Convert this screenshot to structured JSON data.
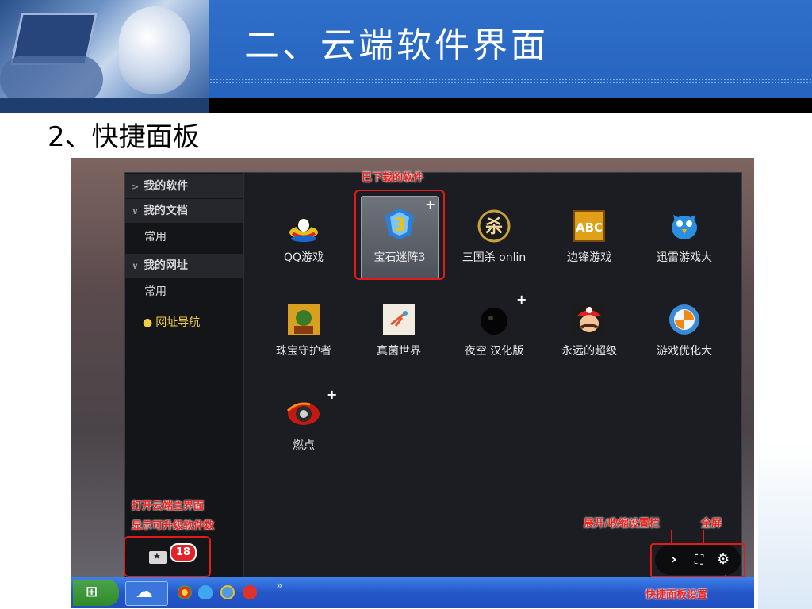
{
  "slide": {
    "title": "二、云端软件界面",
    "subtitle": "2、快捷面板"
  },
  "sidebar": {
    "items": [
      {
        "type": "category",
        "arrow": ">",
        "label": "我的软件"
      },
      {
        "type": "category",
        "arrow": "∨",
        "label": "我的文档"
      },
      {
        "type": "item",
        "label": "常用"
      },
      {
        "type": "category",
        "arrow": "∨",
        "label": "我的网址"
      },
      {
        "type": "item",
        "label": "常用"
      },
      {
        "type": "nav",
        "label": "网址导航"
      }
    ]
  },
  "apps": [
    {
      "label": "QQ游戏",
      "icon": "qq-penguin-icon"
    },
    {
      "label": "宝石迷阵3",
      "icon": "bejeweled-3-icon",
      "selected": true,
      "plus": "+"
    },
    {
      "label": "三国杀 onlin",
      "icon": "sanguosha-icon"
    },
    {
      "label": "边锋游戏",
      "icon": "abc-game-icon"
    },
    {
      "label": "迅雷游戏大",
      "icon": "xunlei-bird-icon"
    },
    {
      "label": "珠宝守护者",
      "icon": "jewel-keeper-icon"
    },
    {
      "label": "真菌世界",
      "icon": "fungi-world-icon"
    },
    {
      "label": "夜空 汉化版",
      "icon": "night-sky-icon",
      "plus": "+"
    },
    {
      "label": "永远的超级",
      "icon": "super-mario-icon"
    },
    {
      "label": "游戏优化大",
      "icon": "game-optimizer-icon"
    },
    {
      "label": "燃点",
      "icon": "randian-icon",
      "plus": "+"
    }
  ],
  "annotations": {
    "downloaded": "已下载的软件",
    "open_main_1": "打开云端主界面",
    "open_main_2": "显示可升级软件数",
    "expand": "展开/收缩设置栏",
    "fullscreen": "全屏",
    "settings": "快捷面板设置"
  },
  "badge": {
    "count": "18"
  },
  "controls": {
    "expand": "›",
    "fullscreen": "⛶",
    "settings": "⚙"
  },
  "taskbar": {
    "chevron": "»"
  },
  "colors": {
    "accent_red": "#e11a1a",
    "header_blue": "#2563bf",
    "taskbar_blue": "#2556c8"
  }
}
